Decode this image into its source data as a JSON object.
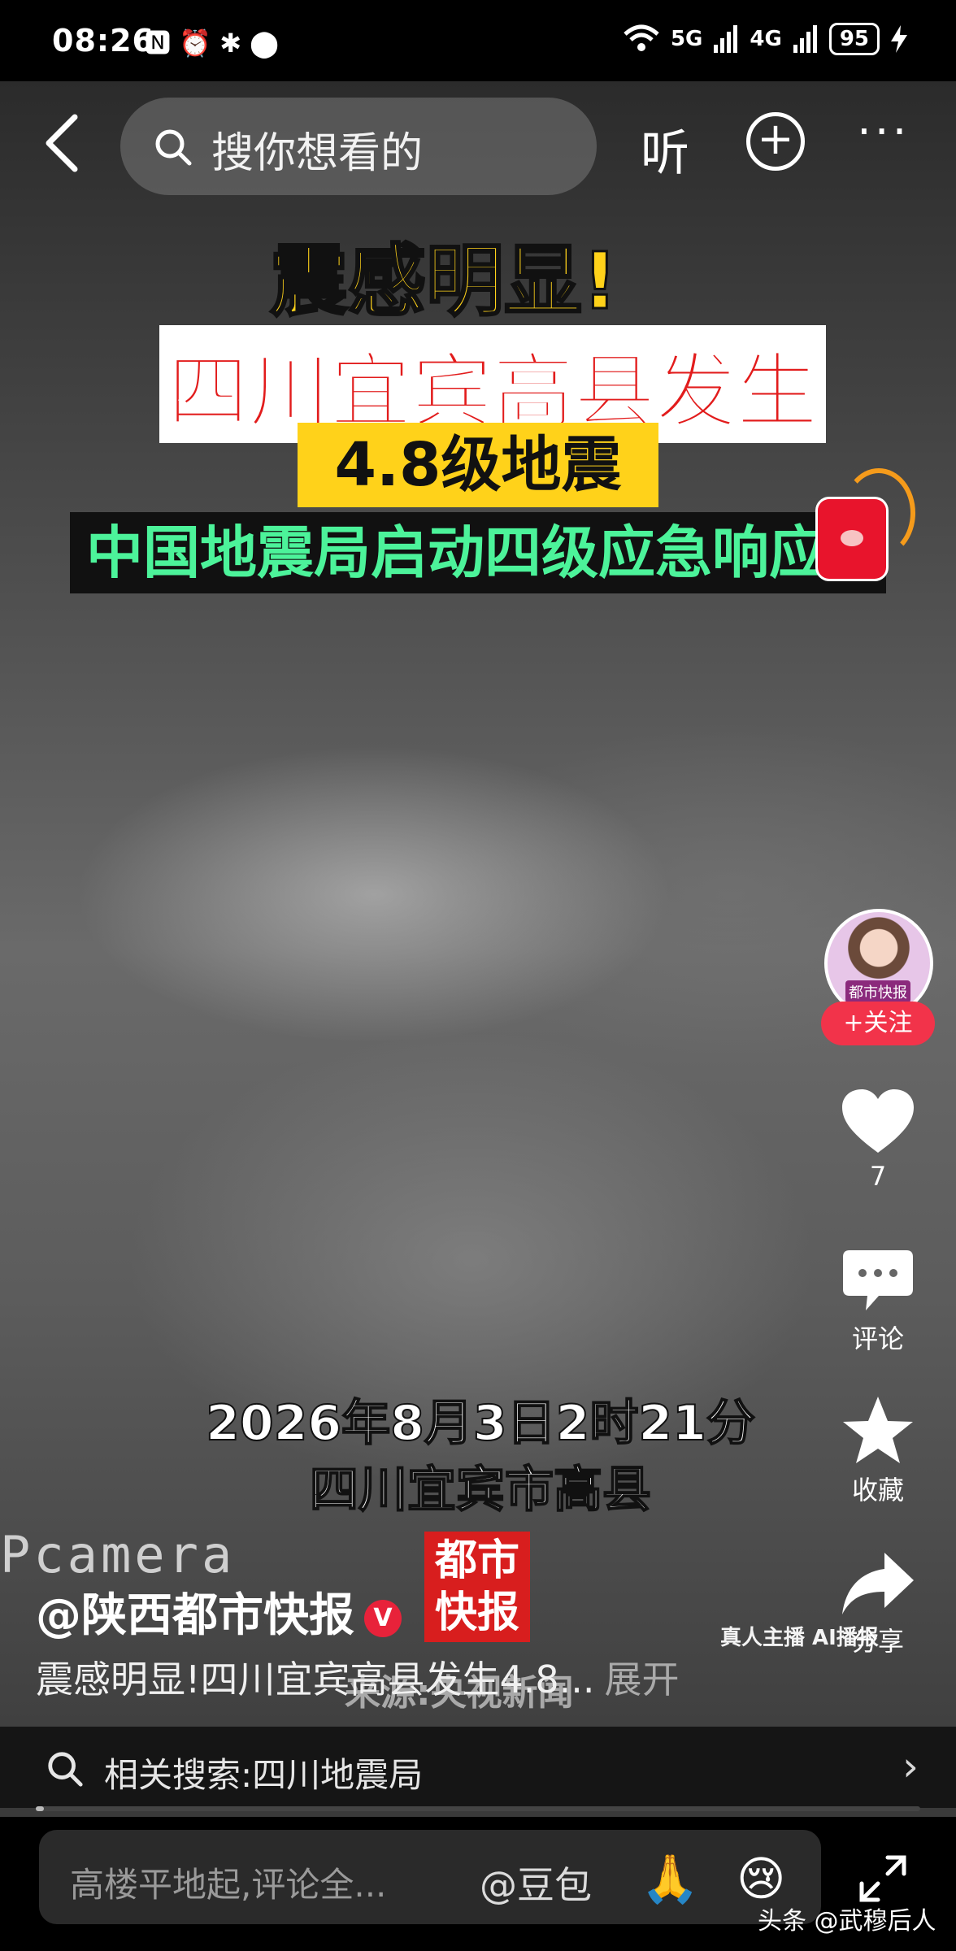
{
  "status_bar": {
    "time": "08:26",
    "left_icons": "🅽 ⏰ ✱ ⬤",
    "signal_1": "5G",
    "signal_2": "4G",
    "battery": "95",
    "wifi_icon": "wifi-icon",
    "charging_icon": "bolt-icon"
  },
  "topnav": {
    "search_placeholder": "搜你想看的",
    "listen_label": "听",
    "plus_label": "+",
    "more_label": "···"
  },
  "video": {
    "caption_line1": "震感明显!",
    "caption_line2": "四川宜宾高县发生",
    "caption_line3": "4.8级地震",
    "caption_line4": "中国地震局启动四级应急响应",
    "date_line1": "2026年8月3日2时21分",
    "date_line2": "四川宜宾市高县",
    "camera_mark": "Pcamera",
    "logo_text": "都市快报",
    "source_text": "来源:央视新闻",
    "ai_tag": "真人主播 AI播报",
    "accent_colors": {
      "yellow": "#ffd21a",
      "red": "#e21c1c",
      "green": "#4cf39a"
    }
  },
  "right_rail": {
    "avatar_label": "都市快报",
    "follow_label": "+关注",
    "like_count": "7",
    "comment_label": "评论",
    "favorite_label": "收藏",
    "share_label": "分享"
  },
  "post": {
    "author": "@陕西都市快报",
    "verified_badge": "V",
    "description": "震感明显!四川宜宾高县发生4.8...",
    "expand_label": "展开"
  },
  "related_search": {
    "text": "相关搜索:四川地震局",
    "chevron": "›"
  },
  "comment_bar": {
    "placeholder": "高楼平地起,评论全...",
    "mention": "@豆包",
    "emoji_1": "🙏",
    "emoji_2": "😢",
    "watermark": "头条 @武穆后人"
  }
}
